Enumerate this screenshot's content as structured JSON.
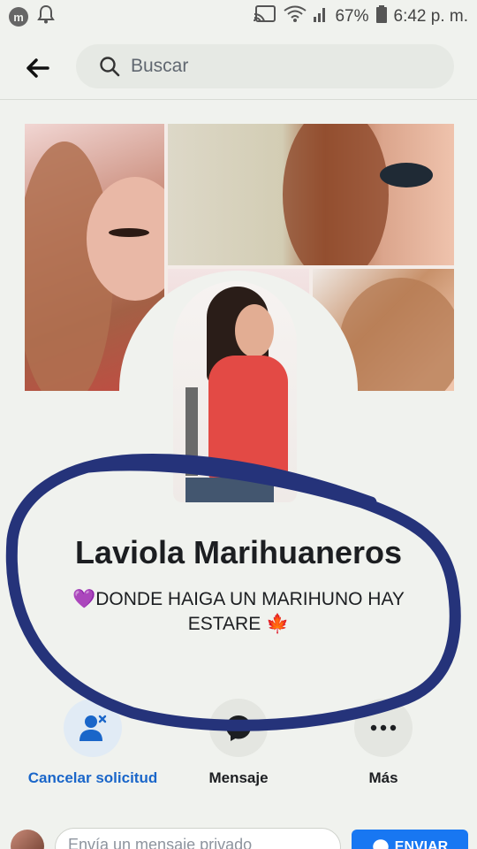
{
  "status_bar": {
    "notification_badge": "m",
    "battery_percent": "67%",
    "time": "6:42 p. m."
  },
  "search": {
    "placeholder": "Buscar"
  },
  "profile": {
    "name": "Laviola Marihuaneros",
    "bio_emoji": "💜",
    "bio_text": "DONDE HAIGA UN MARIHUNO HAY ESTARE",
    "bio_trailing_emoji": "🍁"
  },
  "actions": {
    "cancel_request": "Cancelar solicitud",
    "message": "Mensaje",
    "more": "Más"
  },
  "composer": {
    "placeholder": "Envía un mensaje privado",
    "send_label": "ENVIAR"
  },
  "colors": {
    "accent": "#1877f2",
    "scribble": "#25337a"
  }
}
